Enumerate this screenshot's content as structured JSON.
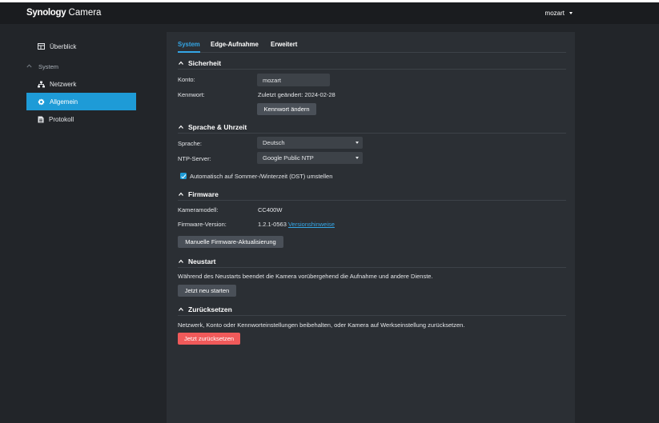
{
  "header": {
    "brand_bold": "Synology",
    "brand_light": " Camera",
    "user": "mozart"
  },
  "sidebar": {
    "overview": "Überblick",
    "group": "System",
    "items": [
      {
        "label": "Netzwerk",
        "icon": "network-icon"
      },
      {
        "label": "Allgemein",
        "icon": "gear-icon",
        "active": true
      },
      {
        "label": "Protokoll",
        "icon": "log-icon"
      }
    ]
  },
  "tabs": [
    "System",
    "Edge-Aufnahme",
    "Erweitert"
  ],
  "security": {
    "title": "Sicherheit",
    "account_label": "Konto:",
    "account_value": "mozart",
    "password_label": "Kennwort:",
    "password_changed": "Zuletzt geändert: 2024-02-28",
    "change_password": "Kennwort ändern"
  },
  "language": {
    "title": "Sprache & Uhrzeit",
    "language_label": "Sprache:",
    "language_value": "Deutsch",
    "ntp_label": "NTP-Server:",
    "ntp_value": "Google Public NTP",
    "dst_label": "Automatisch auf Sommer-/Winterzeit (DST) umstellen",
    "dst_checked": true
  },
  "firmware": {
    "title": "Firmware",
    "model_label": "Kameramodell:",
    "model_value": "CC400W",
    "version_label": "Firmware-Version:",
    "version_value": "1.2.1-0563",
    "release_notes": "Versionshinweise",
    "manual_update": "Manuelle Firmware-Aktualisierung"
  },
  "restart": {
    "title": "Neustart",
    "description": "Während des Neustarts beendet die Kamera vorübergehend die Aufnahme und andere Dienste.",
    "button": "Jetzt neu starten"
  },
  "reset": {
    "title": "Zurücksetzen",
    "description": "Netzwerk, Konto oder Kennworteinstellungen beibehalten, oder Kamera auf Werkseinstellung zurücksetzen.",
    "button": "Jetzt zurücksetzen"
  },
  "colors": {
    "accent": "#1e9bd7",
    "danger": "#f05a5a",
    "panel": "#2b2f34",
    "background": "#222529"
  }
}
